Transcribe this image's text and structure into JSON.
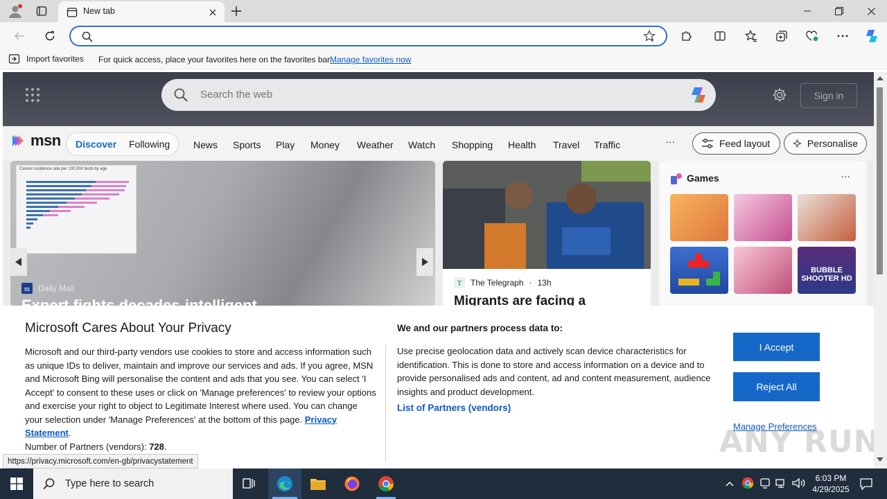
{
  "browser": {
    "tab_title": "New tab",
    "address_value": "",
    "address_placeholder": ""
  },
  "favorites_bar": {
    "import_label": "Import favorites",
    "message": "For quick access, place your favorites here on the favorites bar.",
    "manage_link": "Manage favorites now"
  },
  "msn": {
    "search_placeholder": "Search the web",
    "signin_label": "Sign in",
    "logo_text": "msn",
    "nav_pill": [
      "Discover",
      "Following"
    ],
    "nav_links": [
      "News",
      "Sports",
      "Play",
      "Money",
      "Weather",
      "Watch",
      "Shopping",
      "Health",
      "Travel",
      "Traffic"
    ],
    "nav_more": "···",
    "feed_layout_label": "Feed layout",
    "personalise_label": "Personalise",
    "main_card": {
      "chart_title": "Cancer incidence rate per 100,000 birds by age",
      "source": "Daily Mail",
      "headline": "Expert fights decades-intelligent..."
    },
    "second_card": {
      "source": "The Telegraph",
      "age": "13h",
      "headline": "Migrants are facing a"
    },
    "games": {
      "title": "Games",
      "more": "···",
      "tile_labels": [
        "BUBBLE SHOOTER HD"
      ]
    }
  },
  "privacy": {
    "title": "Microsoft Cares About Your Privacy",
    "body_1": "Microsoft and our third-party vendors use cookies to store and access information such as unique IDs to deliver, maintain and improve our services and ads. If you agree, MSN and Microsoft Bing will personalise the content and ads that you see. You can select 'I Accept' to consent to these uses or click on 'Manage preferences' to review your options and exercise your right to object to Legitimate Interest where used.  You can change your selection under 'Manage Preferences' at the bottom of this page.",
    "privacy_link": "Privacy Statement",
    "partners_count_label": "Number of Partners (vendors):",
    "partners_count": "728",
    "right_title": "We and our partners process data to:",
    "right_body": "Use precise geolocation data and actively scan device characteristics for identification. This is done to store and access information on a device and to provide personalised ads and content, ad and content measurement, audience insights and product development.",
    "partners_link": "List of Partners (vendors)",
    "accept_label": "I Accept",
    "reject_label": "Reject All",
    "manage_label": "Manage Preferences"
  },
  "status_url": "https://privacy.microsoft.com/en-gb/privacystatement",
  "taskbar": {
    "search_placeholder": "Type here to search",
    "time": "6:03 PM",
    "date": "4/29/2025"
  },
  "watermark": "ANY RUN",
  "colors": {
    "accent": "#1668c8",
    "link": "#0b58c8",
    "taskbar": "#1f2d3c"
  }
}
